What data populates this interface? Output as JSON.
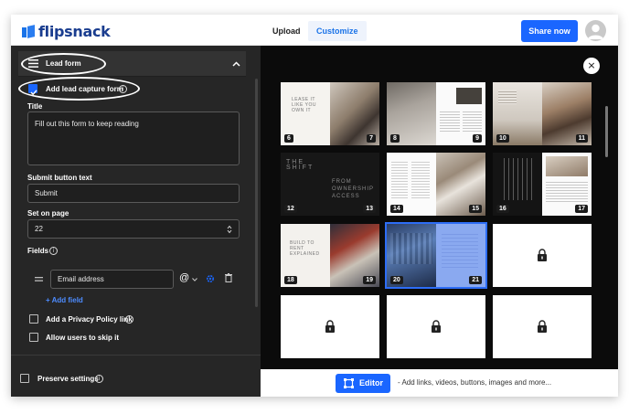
{
  "app": {
    "logo_text": "flipsnack"
  },
  "topbar": {
    "tabs": [
      {
        "label": "Upload"
      },
      {
        "label": "Customize"
      }
    ],
    "share_label": "Share now"
  },
  "panel": {
    "section_title": "Lead form",
    "add_form_label": "Add lead capture form",
    "title_label": "Title",
    "title_value": "Fill out this form to keep reading",
    "submit_label": "Submit button text",
    "submit_value": "Submit",
    "page_label": "Set on page",
    "page_value": "22",
    "fields_label": "Fields",
    "field_value": "Email address",
    "field_type_symbol": "@",
    "add_field_label": "+ Add field",
    "privacy_label": "Add a Privacy Policy link",
    "skip_label": "Allow users to skip it",
    "preserve_label": "Preserve settings"
  },
  "preview": {
    "page_numbers": [
      "6",
      "7",
      "8",
      "9",
      "10",
      "11",
      "12",
      "13",
      "14",
      "15",
      "16",
      "17",
      "18",
      "19",
      "20",
      "21"
    ],
    "cover_texts": {
      "p6": "LEASE IT LIKE YOU OWN IT",
      "p12": "THE SHIFT",
      "p13": "FROM OWNERSHIP ACCESS",
      "p18": "BUILD TO RENT EXPLAINED"
    },
    "locked_count": 4
  },
  "bottombar": {
    "editor_label": "Editor",
    "hint": "- Add links, videos, buttons, images and more..."
  },
  "colors": {
    "accent": "#1a66ff",
    "panel_bg": "#262626",
    "preview_bg": "#0b0b0b"
  }
}
